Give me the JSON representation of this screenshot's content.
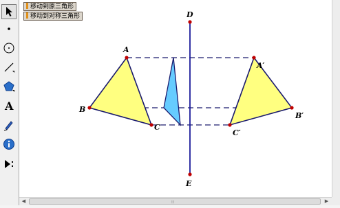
{
  "buttons": {
    "move_to_original": "移动到原三角形",
    "move_to_symmetric": "移动到对称三角形"
  },
  "points": {
    "A": "A",
    "B": "B",
    "C": "C",
    "A_prime": "A′",
    "B_prime": "B′",
    "C_prime": "C′",
    "D": "D",
    "E": "E"
  },
  "tools": [
    "arrow-select-icon",
    "point-icon",
    "compass-circle-icon",
    "straightedge-icon",
    "polygon-icon",
    "text-tool-icon",
    "marker-pen-icon",
    "information-icon",
    "custom-tools-icon"
  ],
  "colors": {
    "triangle_fill": "#ffff80",
    "triangle_edge": "#1a1a6e",
    "axis_line": "#1a1a9a",
    "dashed_line": "#1a1a6e",
    "point": "#c00000",
    "moving_triangle_fill": "#66ccff",
    "button_tab": "#e0901a"
  },
  "scrollbar": {
    "horizontal_grip": "⦙⦙⦙"
  }
}
